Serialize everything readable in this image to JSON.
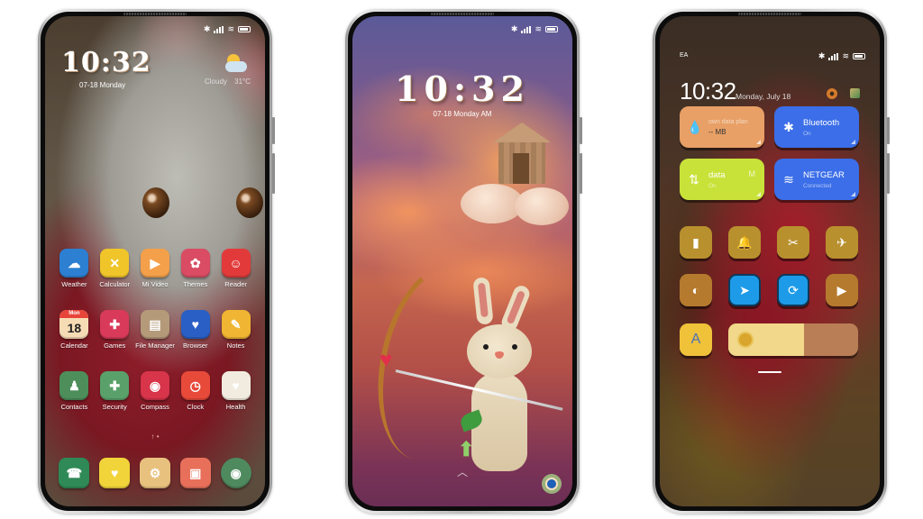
{
  "status_bar": {
    "icons": [
      "bluetooth-icon",
      "signal-icon",
      "wifi-icon",
      "battery-icon"
    ],
    "bluetooth_glyph": "✱",
    "wifi_glyph": "≋"
  },
  "home_screen": {
    "time": "10:32",
    "date": "07-18 Monday",
    "weather": {
      "condition": "Cloudy",
      "temperature": "31°C",
      "icon": "cloudy-sun-icon"
    },
    "apps": [
      {
        "label": "Weather",
        "icon": "weather-icon",
        "color": "#2c7fd1",
        "glyph": "☁"
      },
      {
        "label": "Calculator",
        "icon": "calculator-icon",
        "color": "#f0c52a",
        "glyph": "✕"
      },
      {
        "label": "Mi Video",
        "icon": "video-icon",
        "color": "#f4a04a",
        "glyph": "▶"
      },
      {
        "label": "Themes",
        "icon": "themes-icon",
        "color": "#d94c63",
        "glyph": "✿"
      },
      {
        "label": "Reader",
        "icon": "reader-icon",
        "color": "#e23a3a",
        "glyph": "☺"
      },
      {
        "label": "Calendar",
        "icon": "calendar-icon",
        "color": "#f6dcb5",
        "glyph": "18",
        "sub": "Mon"
      },
      {
        "label": "Games",
        "icon": "games-icon",
        "color": "#d93a5a",
        "glyph": "✚"
      },
      {
        "label": "File Manager",
        "icon": "file-manager-icon",
        "color": "#b59a7a",
        "glyph": "▤"
      },
      {
        "label": "Browser",
        "icon": "browser-icon",
        "color": "#2a5fc5",
        "glyph": "♥"
      },
      {
        "label": "Notes",
        "icon": "notes-icon",
        "color": "#f0b532",
        "glyph": "✎"
      },
      {
        "label": "Contacts",
        "icon": "contacts-icon",
        "color": "#4d8e5a",
        "glyph": "♟"
      },
      {
        "label": "Security",
        "icon": "security-icon",
        "color": "#5aa06a",
        "glyph": "✚"
      },
      {
        "label": "Compass",
        "icon": "compass-icon",
        "color": "#d8344a",
        "glyph": "◉"
      },
      {
        "label": "Clock",
        "icon": "clock-icon",
        "color": "#e84a3a",
        "glyph": "◷"
      },
      {
        "label": "Health",
        "icon": "health-icon",
        "color": "#f2ece0",
        "glyph": "♥"
      }
    ],
    "dock": [
      {
        "icon": "phone-icon",
        "color": "#2f8a57",
        "glyph": "☎"
      },
      {
        "icon": "messages-icon",
        "color": "#f1d43a",
        "glyph": "♥"
      },
      {
        "icon": "settings-icon",
        "color": "#e8c17e",
        "glyph": "⚙"
      },
      {
        "icon": "gallery-icon",
        "color": "#e8705a",
        "glyph": "▣"
      },
      {
        "icon": "camera-icon",
        "color": "#4e8a5e",
        "glyph": "◉"
      }
    ],
    "page_indicator": "↑ •"
  },
  "lock_screen": {
    "time": "10:32",
    "date": "07-18 Monday AM",
    "swipe_hint": "︿",
    "camera_shortcut": "camera-icon"
  },
  "control_center": {
    "carrier": "EA",
    "time": "10:32",
    "date": "Monday, July 18",
    "tiles": [
      {
        "title": "own data plan",
        "subtitle": "-- MB",
        "icon": "data-drop-icon",
        "glyph": "💧",
        "color": "#e8a066",
        "active": false
      },
      {
        "title": "Bluetooth",
        "subtitle": "On",
        "icon": "bluetooth-icon",
        "glyph": "✱",
        "color": "#3b6ee8",
        "active": true
      },
      {
        "title": "data",
        "title_suffix": "M",
        "subtitle": "On",
        "icon": "mobile-data-icon",
        "glyph": "⇅",
        "color": "#c9e23a",
        "active": true
      },
      {
        "title": "NETGEAR",
        "subtitle": "Connected",
        "icon": "wifi-icon",
        "glyph": "≋",
        "color": "#3b6ee8",
        "active": true
      }
    ],
    "toggles": [
      {
        "icon": "flashlight-icon",
        "glyph": "▮",
        "color": "#b8902e",
        "active": false
      },
      {
        "icon": "bell-icon",
        "glyph": "🔔",
        "color": "#b8902e",
        "active": false
      },
      {
        "icon": "screenshot-icon",
        "glyph": "✂",
        "color": "#b8902e",
        "active": false
      },
      {
        "icon": "airplane-icon",
        "glyph": "✈",
        "color": "#b8902e",
        "active": false
      },
      {
        "icon": "dark-mode-icon",
        "glyph": "◐",
        "color": "#b57a2e",
        "active": false
      },
      {
        "icon": "location-icon",
        "glyph": "➤",
        "color": "#1e9be8",
        "active": true
      },
      {
        "icon": "rotation-lock-icon",
        "glyph": "⟳",
        "color": "#1e9be8",
        "active": true
      },
      {
        "icon": "video-record-icon",
        "glyph": "▶",
        "color": "#b57a2e",
        "active": false
      }
    ],
    "auto_brightness": {
      "label": "A",
      "color": "#f0c23a"
    },
    "brightness_percent": 58
  }
}
